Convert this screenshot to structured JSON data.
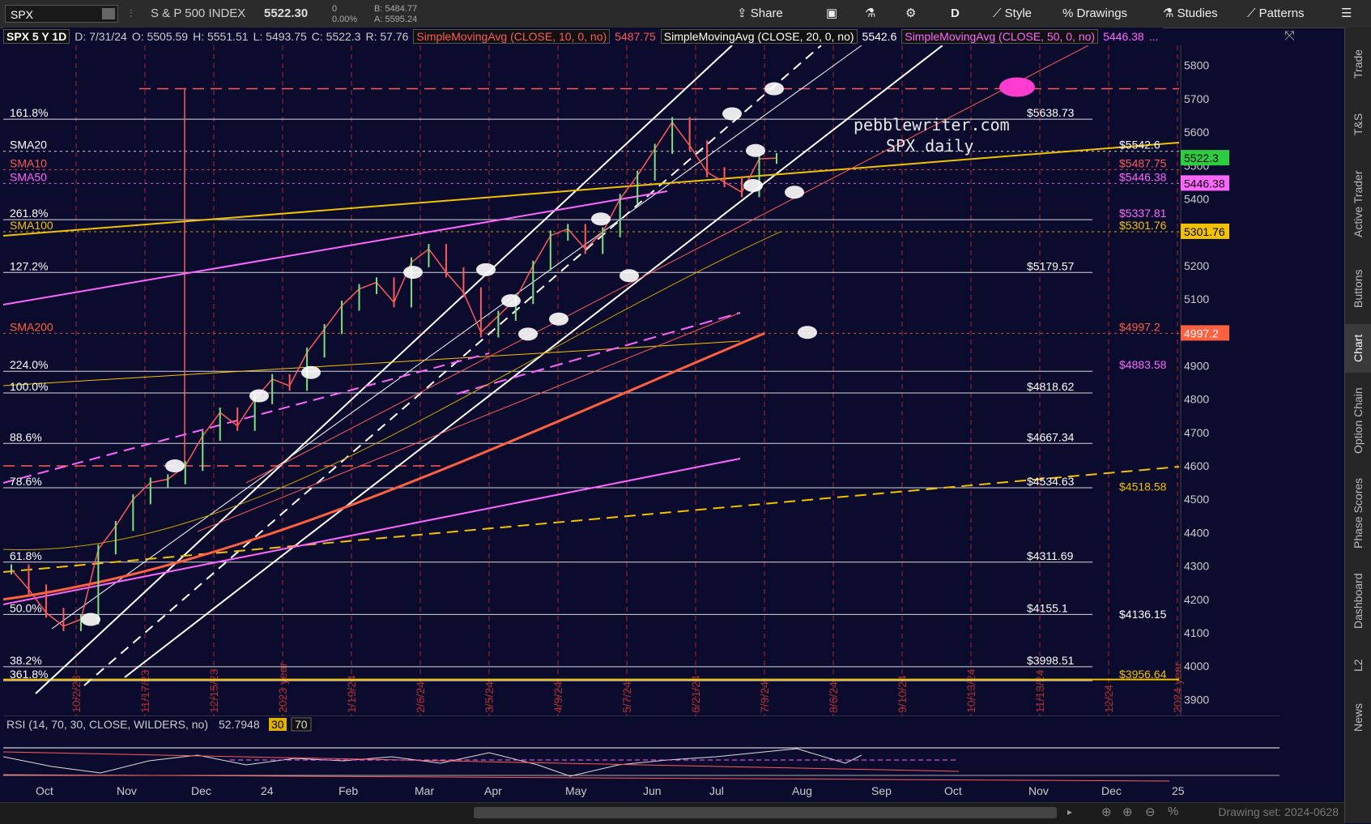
{
  "toolbar": {
    "symbol": "SPX",
    "name": "S & P 500 INDEX",
    "last": "5522.30",
    "change": "0",
    "change_pct": "0.00%",
    "bid": "B: 5484.77",
    "ask": "A: 5595.24",
    "share": "Share",
    "period": "D",
    "style": "Style",
    "drawings": "Drawings",
    "studies": "Studies",
    "patterns": "Patterns"
  },
  "info": {
    "title": "SPX 5 Y 1D",
    "date": "D: 7/31/24",
    "open": "O: 5505.59",
    "high": "H: 5551.51",
    "low": "L: 5493.75",
    "close": "C: 5522.3",
    "range": "R: 57.76",
    "sma10": "SimpleMovingAvg (CLOSE, 10, 0, no)",
    "sma10_val": "5487.75",
    "sma20": "SimpleMovingAvg (CLOSE, 20, 0, no)",
    "sma20_val": "5542.6",
    "sma50": "SimpleMovingAvg (CLOSE, 50, 0, no)",
    "sma50_val": "5446.38",
    "more": "..."
  },
  "watermark": {
    "line1": "pebblewriter.com",
    "line2": "SPX daily"
  },
  "colors": {
    "bg": "#0b0b2e",
    "sma10": "#ff5a5a",
    "sma20": "#ffffff",
    "sma50": "#ff66ff",
    "sma100": "#f2c200",
    "sma200": "#ff6040",
    "price_tag": "#2ecc40"
  },
  "chart_data": {
    "type": "line",
    "title": "SPX 5 Y 1D",
    "ylim": [
      3850,
      5860
    ],
    "y_ticks": [
      "5800",
      "5700",
      "5600",
      "5500",
      "5400",
      "5300",
      "5200",
      "5100",
      "5000",
      "4900",
      "4800",
      "4700",
      "4600",
      "4500",
      "4400",
      "4300",
      "4200",
      "4100",
      "4000",
      "3900"
    ],
    "x_ticks": [
      "Oct",
      "Nov",
      "Dec",
      "24",
      "Feb",
      "Mar",
      "Apr",
      "May",
      "Jun",
      "Jul",
      "Aug",
      "Sep",
      "Oct",
      "Nov",
      "Dec",
      "25"
    ],
    "date_markers": [
      "10/2/23",
      "11/17/23",
      "12/15/23",
      "2023 year",
      "1/19/24",
      "2/6/24",
      "3/5/24",
      "4/9/24",
      "5/7/24",
      "6/21/24",
      "7/9/24",
      "8/6/24",
      "9/10/24",
      "10/13/24",
      "11/13/24",
      "12/24",
      "2024 year"
    ],
    "fib_left": [
      {
        "label": "161.8%",
        "value": 5638.73
      },
      {
        "label": "SMA20",
        "value": 5542.6
      },
      {
        "label": "SMA10",
        "value": 5487.75
      },
      {
        "label": "SMA50",
        "value": 5446.38
      },
      {
        "label": "261.8%",
        "value": 5337.81
      },
      {
        "label": "SMA100",
        "value": 5301.76
      },
      {
        "label": "127.2%",
        "value": 5179.57
      },
      {
        "label": "SMA200",
        "value": 4997.2
      },
      {
        "label": "224.0%",
        "value": 4883.58
      },
      {
        "label": "100.0%",
        "value": 4818.62
      },
      {
        "label": "88.6%",
        "value": 4667.34
      },
      {
        "label": "78.6%",
        "value": 4534.63
      },
      {
        "label": "61.8%",
        "value": 4311.69
      },
      {
        "label": "50.0%",
        "value": 4155.1
      },
      {
        "label": "38.2%",
        "value": 3998.51
      },
      {
        "label": "361.8%",
        "value": 3956.64
      }
    ],
    "levels_right": [
      {
        "label": "$5638.73",
        "value": 5638.73
      },
      {
        "label": "$5542.6",
        "value": 5542.6
      },
      {
        "label": "$5487.75",
        "value": 5487.75
      },
      {
        "label": "$5446.38",
        "value": 5446.38
      },
      {
        "label": "$5337.81",
        "value": 5337.81
      },
      {
        "label": "$5301.76",
        "value": 5301.76
      },
      {
        "label": "$5179.57",
        "value": 5179.57
      },
      {
        "label": "$4997.2",
        "value": 4997.2
      },
      {
        "label": "$4883.58",
        "value": 4883.58
      },
      {
        "label": "$4818.62",
        "value": 4818.62
      },
      {
        "label": "$4667.34",
        "value": 4667.34
      },
      {
        "label": "$4534.63",
        "value": 4534.63
      },
      {
        "label": "$4518.58",
        "value": 4518.58
      },
      {
        "label": "$4311.69",
        "value": 4311.69
      },
      {
        "label": "$4155.1",
        "value": 4155.1
      },
      {
        "label": "$4136.15",
        "value": 4136.15
      },
      {
        "label": "$3998.51",
        "value": 3998.51
      },
      {
        "label": "$3956.64",
        "value": 3956.64
      }
    ],
    "axis_tags": [
      {
        "label": "5522.3",
        "value": 5522.3
      },
      {
        "label": "5446.38",
        "value": 5446.38
      },
      {
        "label": "5301.76",
        "value": 5301.76
      },
      {
        "label": "4997.2",
        "value": 4997.2
      }
    ],
    "close_series": [
      4290,
      4230,
      4160,
      4120,
      4140,
      4350,
      4420,
      4500,
      4550,
      4560,
      4600,
      4690,
      4760,
      4720,
      4800,
      4860,
      4840,
      4940,
      5010,
      5080,
      5130,
      5150,
      5090,
      5210,
      5250,
      5180,
      5120,
      5000,
      5050,
      5100,
      5200,
      5290,
      5310,
      5250,
      5300,
      5400,
      5470,
      5550,
      5630,
      5560,
      5480,
      5450,
      5420,
      5520,
      5522.3
    ]
  },
  "rsi": {
    "label": "RSI (14, 70, 30, CLOSE, WILDERS, no)",
    "value": "52.7948",
    "level1": "30",
    "level2": "70",
    "tick": "75"
  },
  "sidebar": [
    "Trade",
    "T&S",
    "Active Trader",
    "Buttons",
    "Chart",
    "Option Chain",
    "Phase Scores",
    "Dashboard",
    "L2",
    "News"
  ],
  "bottom": {
    "drawing_set": "Drawing set: 2024-0628"
  }
}
